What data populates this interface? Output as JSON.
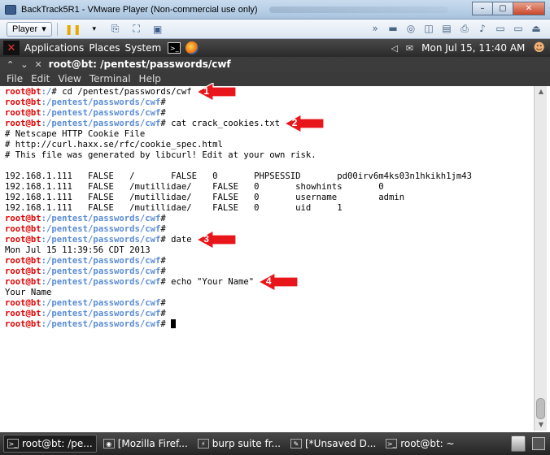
{
  "window": {
    "title": "BackTrack5R1 - VMware Player (Non-commercial use only)",
    "minimize": "–",
    "maximize": "▢",
    "close": "✕"
  },
  "vmware_toolbar": {
    "player_label": "Player"
  },
  "gnome_panel": {
    "menus": [
      "Applications",
      "Places",
      "System"
    ],
    "datetime": "Mon Jul 15, 11:40 AM"
  },
  "terminal": {
    "title": "root@bt: /pentest/passwords/cwf",
    "menu": [
      "File",
      "Edit",
      "View",
      "Terminal",
      "Help"
    ],
    "prompt_user": "root@bt",
    "prompt_path": ":/pentest/passwords/cwf",
    "prompt_symbol": "# ",
    "lines": [
      {
        "type": "prompt",
        "path": ":/",
        "cmd": "cd /pentest/passwords/cwf"
      },
      {
        "type": "prompt",
        "cmd": ""
      },
      {
        "type": "prompt",
        "cmd": ""
      },
      {
        "type": "prompt",
        "cmd": "cat crack_cookies.txt"
      },
      {
        "type": "output",
        "text": "# Netscape HTTP Cookie File"
      },
      {
        "type": "output",
        "text": "# http://curl.haxx.se/rfc/cookie_spec.html"
      },
      {
        "type": "output",
        "text": "# This file was generated by libcurl! Edit at your own risk."
      },
      {
        "type": "output",
        "text": ""
      },
      {
        "type": "output",
        "text": "192.168.1.111   FALSE   /       FALSE   0       PHPSESSID       pd00irv6m4ks03n1hkikh1jm43"
      },
      {
        "type": "output",
        "text": "192.168.1.111   FALSE   /mutillidae/    FALSE   0       showhints       0"
      },
      {
        "type": "output",
        "text": "192.168.1.111   FALSE   /mutillidae/    FALSE   0       username        admin"
      },
      {
        "type": "output",
        "text": "192.168.1.111   FALSE   /mutillidae/    FALSE   0       uid     1"
      },
      {
        "type": "prompt",
        "cmd": ""
      },
      {
        "type": "prompt",
        "cmd": ""
      },
      {
        "type": "prompt",
        "cmd": "date"
      },
      {
        "type": "output",
        "text": "Mon Jul 15 11:39:56 CDT 2013"
      },
      {
        "type": "prompt",
        "cmd": ""
      },
      {
        "type": "prompt",
        "cmd": ""
      },
      {
        "type": "prompt",
        "cmd": "echo \"Your Name\""
      },
      {
        "type": "output",
        "text": "Your Name"
      },
      {
        "type": "prompt",
        "cmd": ""
      },
      {
        "type": "prompt",
        "cmd": ""
      },
      {
        "type": "prompt",
        "cmd": "",
        "cursor": true
      }
    ]
  },
  "annotations": [
    {
      "label": "1",
      "line": 0
    },
    {
      "label": "2",
      "line": 3
    },
    {
      "label": "3",
      "line": 14
    },
    {
      "label": "4",
      "line": 18
    }
  ],
  "annotation_color": "#e8161b",
  "taskbar": {
    "tasks": [
      {
        "label": "root@bt: /pe...",
        "icon": "terminal-icon",
        "active": true
      },
      {
        "label": "[Mozilla Firef...",
        "icon": "firefox-icon",
        "active": false
      },
      {
        "label": "burp suite fr...",
        "icon": "burp-icon",
        "active": false
      },
      {
        "label": "[*Unsaved D...",
        "icon": "editor-icon",
        "active": false
      },
      {
        "label": "root@bt: ~",
        "icon": "terminal-icon",
        "active": false
      }
    ]
  }
}
